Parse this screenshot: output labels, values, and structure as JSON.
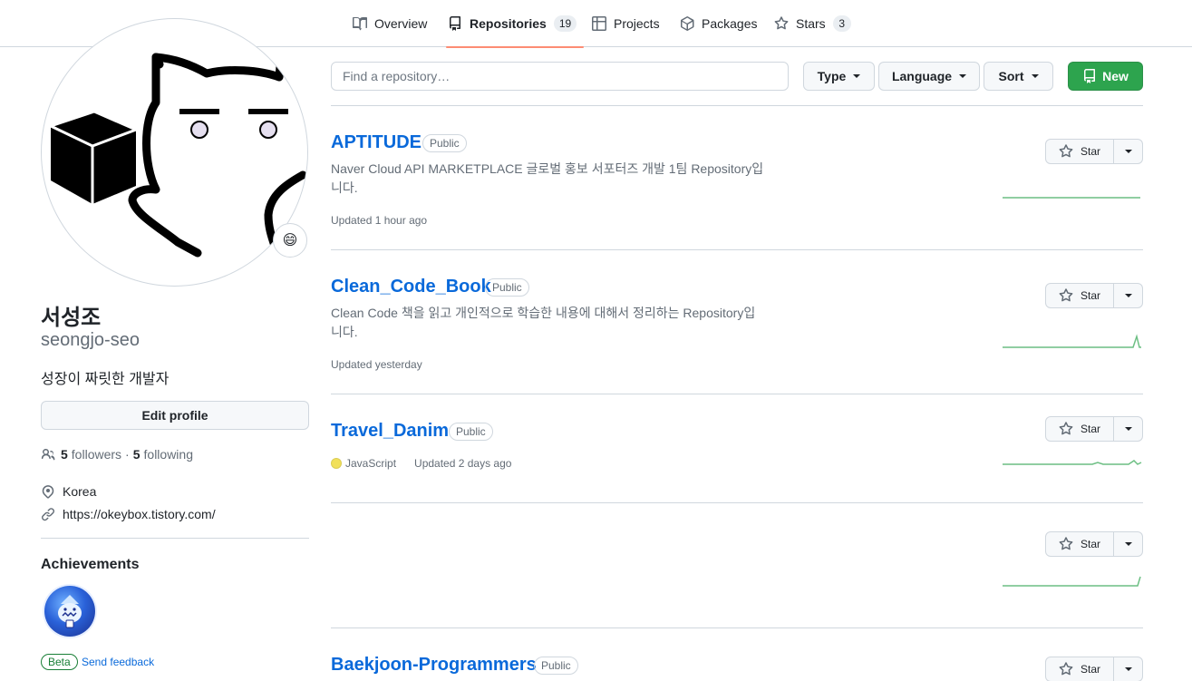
{
  "tabs": [
    {
      "label": "Overview",
      "icon": "book-icon"
    },
    {
      "label": "Repositories",
      "icon": "repo-icon",
      "count": "19",
      "active": true
    },
    {
      "label": "Projects",
      "icon": "table-icon"
    },
    {
      "label": "Packages",
      "icon": "package-icon"
    },
    {
      "label": "Stars",
      "icon": "star-icon",
      "count": "3"
    }
  ],
  "profile": {
    "fullname": "서성조",
    "login": "seongjo-seo",
    "bio": "성장이 짜릿한 개발자",
    "status_emoji": "😄",
    "edit_label": "Edit profile",
    "followers_count": "5",
    "followers_label": "followers",
    "dot": "·",
    "following_count": "5",
    "following_label": "following",
    "location": "Korea",
    "website": "https://okeybox.tistory.com/"
  },
  "achievements": {
    "title": "Achievements",
    "beta_label": "Beta",
    "feedback_label": "Send feedback"
  },
  "toolbar": {
    "search_placeholder": "Find a repository…",
    "type_label": "Type",
    "language_label": "Language",
    "sort_label": "Sort",
    "new_label": "New"
  },
  "repos": [
    {
      "name": "APTITUDE",
      "visibility": "Public",
      "description": "Naver Cloud API MARKETPLACE 글로벌 홍보 서포터즈 개발 1팀 Repository입니다.",
      "language": "",
      "updated": "Updated 1 hour ago",
      "star_label": "Star"
    },
    {
      "name": "Clean_Code_Book",
      "visibility": "Public",
      "description": "Clean Code 책을 읽고 개인적으로 학습한 내용에 대해서 정리하는 Repository입니다.",
      "language": "",
      "updated": "Updated yesterday",
      "star_label": "Star"
    },
    {
      "name": "Travel_Danim",
      "visibility": "Public",
      "description": "",
      "language": "JavaScript",
      "updated": "Updated 2 days ago",
      "star_label": "Star"
    },
    {
      "name": "",
      "visibility": "",
      "description": "",
      "language": "",
      "updated": "",
      "star_label": "Star"
    },
    {
      "name": "Baekjoon-Programmers",
      "visibility": "Public",
      "description": "",
      "language": "",
      "updated": "",
      "star_label": "Star"
    }
  ],
  "colors": {
    "accent": "#0969da",
    "tab_underline": "#fd8c73",
    "new_button": "#2da44e",
    "sparkline": "#2da44e",
    "javascript": "#f1e05a"
  }
}
